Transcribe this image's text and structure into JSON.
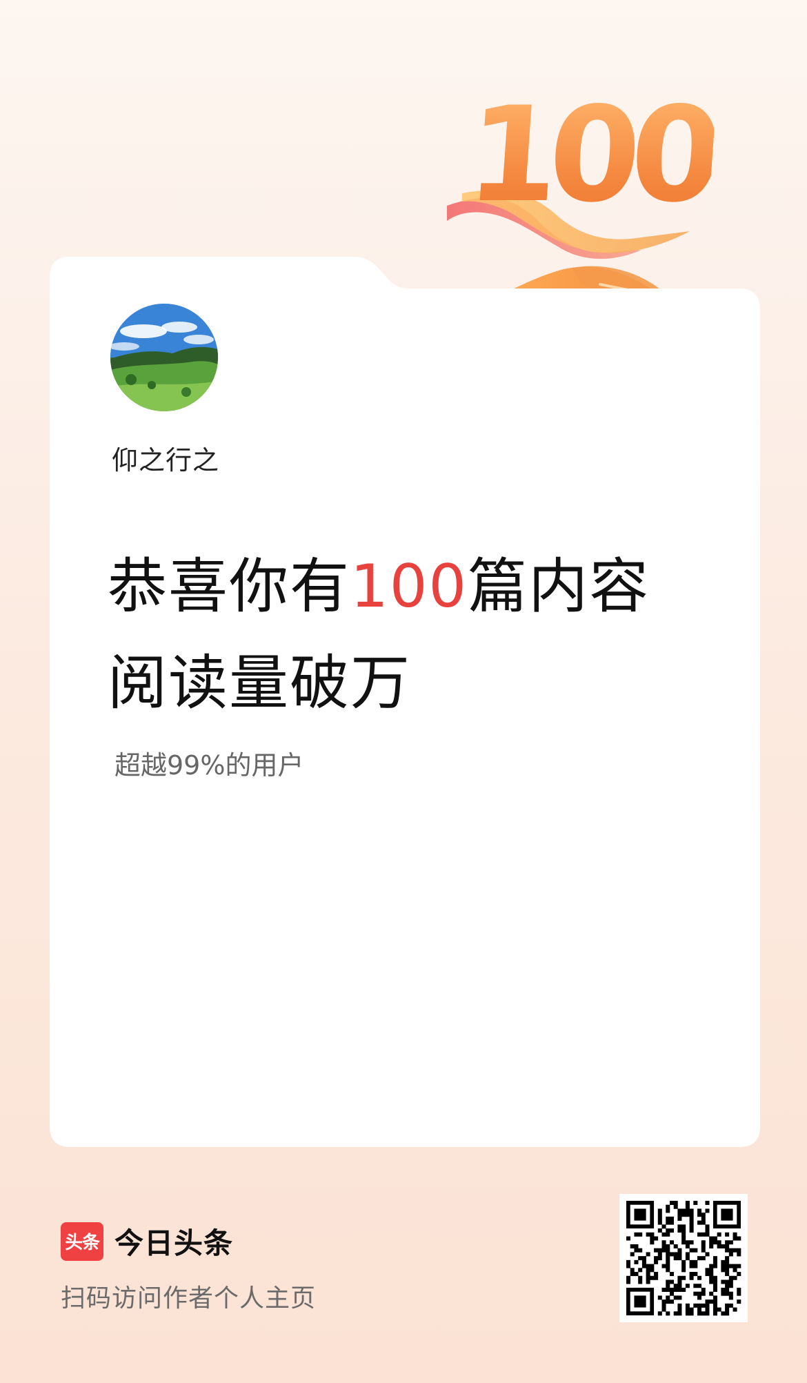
{
  "badge": {
    "number": "100"
  },
  "profile": {
    "avatar_icon": "landscape-avatar",
    "username": "仰之行之"
  },
  "headline": {
    "part1": "恭喜你有",
    "number": "100",
    "part2": "篇内容",
    "line2": "阅读量破万",
    "highlight_color": "#e8423f"
  },
  "subtext": "超越99%的用户",
  "footer": {
    "logo_text": "头条",
    "brand_name": "今日头条",
    "scan_hint": "扫码访问作者个人主页",
    "qr_icon": "qr-code-icon",
    "logo_color": "#f04142"
  }
}
